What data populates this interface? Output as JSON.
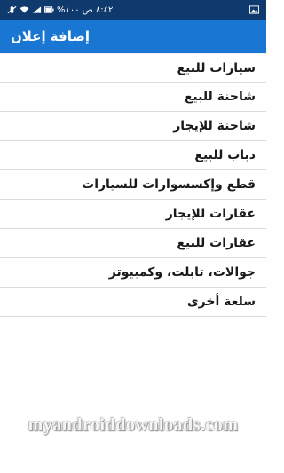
{
  "status_bar": {
    "time": "٨:٤٢ ص",
    "battery_percent": "١٠٠%",
    "icons": [
      "battery-icon",
      "signal-icon",
      "wifi-icon",
      "mute-icon",
      "image-icon"
    ]
  },
  "app_bar": {
    "title": "إضافة إعلان"
  },
  "categories": [
    {
      "label": "سيارات للبيع"
    },
    {
      "label": "شاحنة للبيع"
    },
    {
      "label": "شاحنة للإيجار"
    },
    {
      "label": "دباب للبيع"
    },
    {
      "label": "قطع وإكسسوارات للسيارات"
    },
    {
      "label": "عقارات للإيجار"
    },
    {
      "label": "عقارات للبيع"
    },
    {
      "label": "جوالات، تابلت، وكمبيوتر"
    },
    {
      "label": "سلعة أخرى"
    }
  ],
  "watermark": "myandroiddownloads.com",
  "colors": {
    "status_bar": "#0e3a6e",
    "app_bar": "#1976d2",
    "divider": "#dcdcdc"
  }
}
